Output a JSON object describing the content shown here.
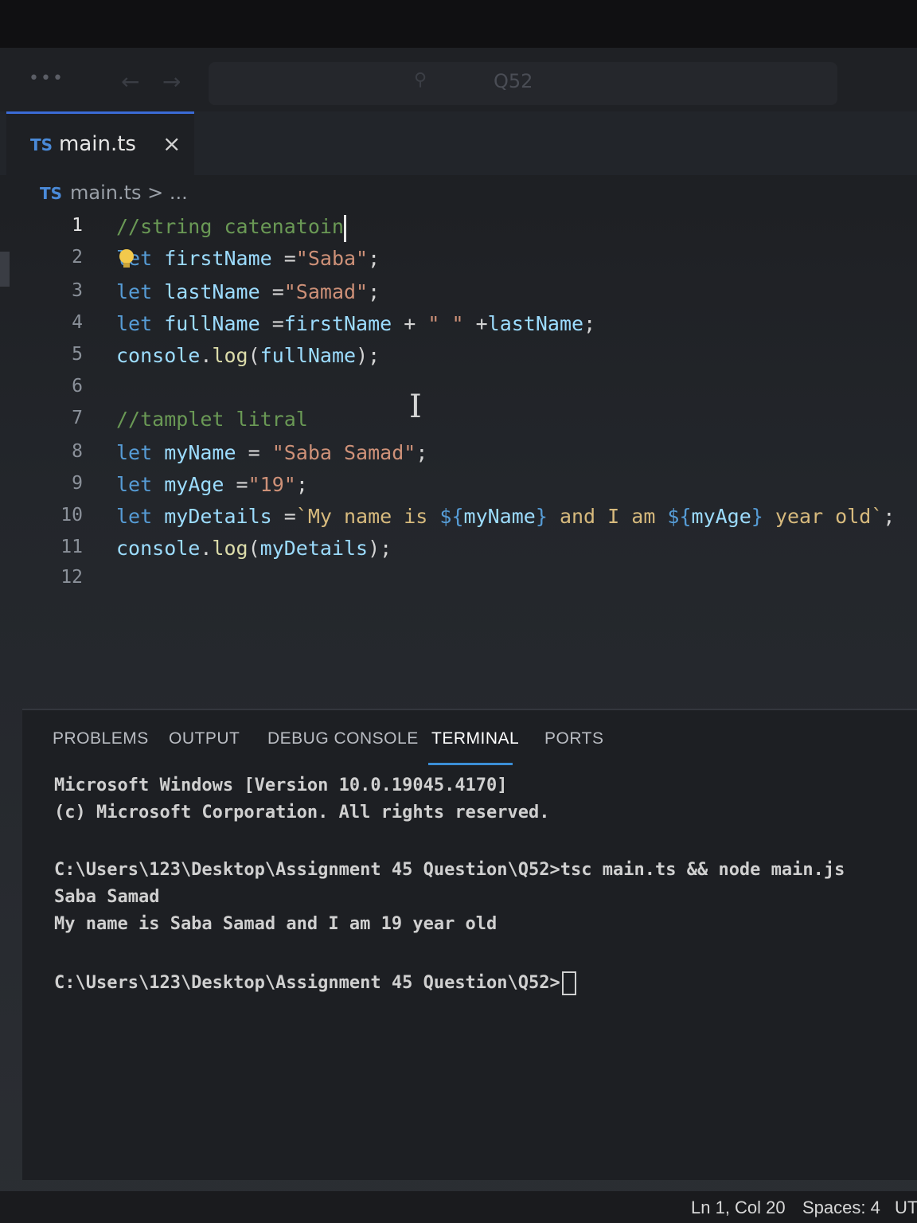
{
  "titlebar": {
    "menu_label": "•••",
    "back_label": "←",
    "forward_label": "→",
    "search_icon": "search-icon",
    "command_center_label": "Q52"
  },
  "tab": {
    "icon_label": "TS",
    "label": "main.ts",
    "close_label": "×"
  },
  "breadcrumb": {
    "icon_label": "TS",
    "text": "main.ts > ..."
  },
  "editor": {
    "lines": [
      {
        "num": "1",
        "tokens": [
          [
            "cm",
            "//string catenatoin"
          ]
        ]
      },
      {
        "num": "2",
        "tokens": [
          [
            "kw",
            "let"
          ],
          [
            "pun",
            " "
          ],
          [
            "var",
            "firstName"
          ],
          [
            "pun",
            " ="
          ],
          [
            "str",
            "\"Saba\""
          ],
          [
            "pun",
            ";"
          ]
        ]
      },
      {
        "num": "3",
        "tokens": [
          [
            "kw",
            "let"
          ],
          [
            "pun",
            " "
          ],
          [
            "var",
            "lastName"
          ],
          [
            "pun",
            " ="
          ],
          [
            "str",
            "\"Samad\""
          ],
          [
            "pun",
            ";"
          ]
        ]
      },
      {
        "num": "4",
        "tokens": [
          [
            "kw",
            "let"
          ],
          [
            "pun",
            " "
          ],
          [
            "var",
            "fullName"
          ],
          [
            "pun",
            " ="
          ],
          [
            "var",
            "firstName"
          ],
          [
            "pun",
            " + "
          ],
          [
            "str",
            "\" \""
          ],
          [
            "pun",
            " +"
          ],
          [
            "var",
            "lastName"
          ],
          [
            "pun",
            ";"
          ]
        ]
      },
      {
        "num": "5",
        "tokens": [
          [
            "var",
            "console"
          ],
          [
            "pun",
            "."
          ],
          [
            "fn",
            "log"
          ],
          [
            "pun",
            "("
          ],
          [
            "var",
            "fullName"
          ],
          [
            "pun",
            ");"
          ]
        ]
      },
      {
        "num": "6",
        "tokens": []
      },
      {
        "num": "7",
        "tokens": [
          [
            "cm",
            "//tamplet litral"
          ]
        ]
      },
      {
        "num": "8",
        "tokens": [
          [
            "kw",
            "let"
          ],
          [
            "pun",
            " "
          ],
          [
            "var",
            "myName"
          ],
          [
            "pun",
            " = "
          ],
          [
            "str",
            "\"Saba Samad\""
          ],
          [
            "pun",
            ";"
          ]
        ]
      },
      {
        "num": "9",
        "tokens": [
          [
            "kw",
            "let"
          ],
          [
            "pun",
            " "
          ],
          [
            "var",
            "myAge"
          ],
          [
            "pun",
            " ="
          ],
          [
            "str",
            "\"19\""
          ],
          [
            "pun",
            ";"
          ]
        ]
      },
      {
        "num": "10",
        "tokens": [
          [
            "kw",
            "let"
          ],
          [
            "pun",
            " "
          ],
          [
            "var",
            "myDetails"
          ],
          [
            "pun",
            " ="
          ],
          [
            "tpl",
            "`My name is "
          ],
          [
            "interp",
            "${"
          ],
          [
            "var",
            "myName"
          ],
          [
            "interp",
            "}"
          ],
          [
            "tpl",
            " and I am "
          ],
          [
            "interp",
            "${"
          ],
          [
            "var",
            "myAge"
          ],
          [
            "interp",
            "}"
          ],
          [
            "tpl",
            " year old`"
          ],
          [
            "pun",
            ";"
          ]
        ]
      },
      {
        "num": "11",
        "tokens": [
          [
            "var",
            "console"
          ],
          [
            "pun",
            "."
          ],
          [
            "fn",
            "log"
          ],
          [
            "pun",
            "("
          ],
          [
            "var",
            "myDetails"
          ],
          [
            "pun",
            ");"
          ]
        ]
      },
      {
        "num": "12",
        "tokens": []
      }
    ],
    "active_line": "1"
  },
  "panel": {
    "tabs": [
      "PROBLEMS",
      "OUTPUT",
      "DEBUG CONSOLE",
      "TERMINAL",
      "PORTS"
    ],
    "active_tab": "TERMINAL"
  },
  "terminal": {
    "lines": [
      "Microsoft Windows [Version 10.0.19045.4170]",
      "(c) Microsoft Corporation. All rights reserved.",
      "",
      "C:\\Users\\123\\Desktop\\Assignment 45 Question\\Q52>tsc main.ts && node main.js",
      "Saba Samad",
      "My name is Saba Samad and I am 19 year old",
      ""
    ],
    "prompt": "C:\\Users\\123\\Desktop\\Assignment 45 Question\\Q52>"
  },
  "statusbar": {
    "position": "Ln 1, Col 20",
    "spaces": "Spaces: 4",
    "encoding": "UT"
  },
  "colors": {
    "comment": "#6a9955",
    "keyword": "#569cd6",
    "variable": "#9cdcfe",
    "string": "#ce9178",
    "function": "#dcdcaa",
    "accent": "#3b8ed6"
  }
}
